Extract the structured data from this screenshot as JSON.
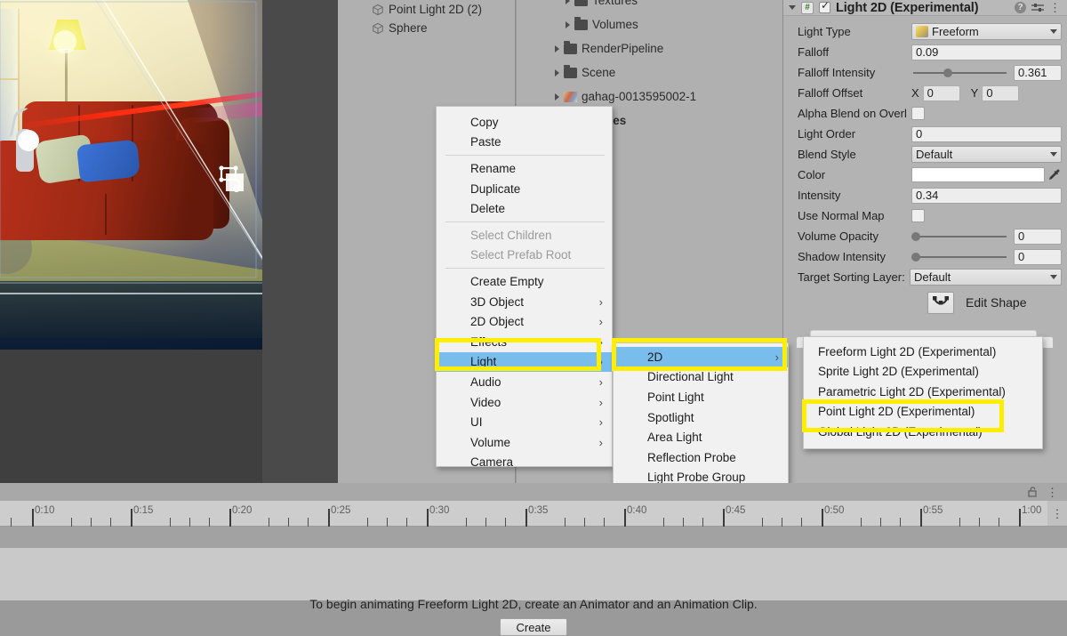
{
  "scene_view": {
    "gizmo_icon": "light-2d-shape-gizmo-icon",
    "description": "2D lit living room scene with red sofa, lamp, cat and pillows"
  },
  "hierarchy": {
    "items": [
      {
        "label": "Point Light 2D (2)",
        "icon": "cube-icon"
      },
      {
        "label": "Sphere",
        "icon": "cube-icon"
      }
    ]
  },
  "project": {
    "items": [
      {
        "label": "Textures",
        "icon": "folder-icon",
        "indent": 2,
        "bold": false,
        "clipped": true
      },
      {
        "label": "Volumes",
        "icon": "folder-icon",
        "indent": 2,
        "bold": false,
        "clipped": false
      },
      {
        "label": "RenderPipeline",
        "icon": "folder-icon",
        "indent": 1,
        "bold": false,
        "clipped": false
      },
      {
        "label": "Scene",
        "icon": "folder-icon",
        "indent": 1,
        "bold": false,
        "clipped": false
      },
      {
        "label": "gahag-0013595002-1",
        "icon": "image-thumb-icon",
        "indent": 1,
        "bold": false,
        "clipped": false
      },
      {
        "label": "Packages",
        "icon": "folder-icon",
        "indent": 0,
        "bold": true,
        "clipped": false
      }
    ]
  },
  "inspector": {
    "title": "Light 2D (Experimental)",
    "enabled": true,
    "icons": {
      "foldout": "chevron-down-icon",
      "script": "script-icon",
      "help": "help-icon",
      "preset": "preset-icon",
      "menu": "kebab-menu-icon"
    },
    "fields": {
      "light_type": {
        "label": "Light Type",
        "value": "Freeform"
      },
      "falloff": {
        "label": "Falloff",
        "value": "0.09"
      },
      "falloff_intensity": {
        "label": "Falloff Intensity",
        "value": "0.361",
        "slider_pct": 36
      },
      "falloff_offset": {
        "label": "Falloff Offset",
        "x_label": "X",
        "x_value": "0",
        "y_label": "Y",
        "y_value": "0"
      },
      "alpha_blend": {
        "label": "Alpha Blend on Overl",
        "checked": false
      },
      "light_order": {
        "label": "Light Order",
        "value": "0"
      },
      "blend_style": {
        "label": "Blend Style",
        "value": "Default"
      },
      "color": {
        "label": "Color",
        "value": "#ffffff"
      },
      "intensity": {
        "label": "Intensity",
        "value": "0.34"
      },
      "use_normal_map": {
        "label": "Use Normal Map",
        "checked": false
      },
      "volume_opacity": {
        "label": "Volume Opacity",
        "value": "0",
        "slider_pct": 0
      },
      "shadow_intensity": {
        "label": "Shadow Intensity",
        "value": "0",
        "slider_pct": 0
      },
      "target_sorting_layer": {
        "label": "Target Sorting Layer:",
        "value": "Default"
      }
    },
    "edit_shape": {
      "label": "Edit Shape",
      "icon": "edit-shape-icon"
    }
  },
  "context_menu": {
    "items": [
      {
        "label": "Copy",
        "type": "item"
      },
      {
        "label": "Paste",
        "type": "item"
      },
      {
        "label": "",
        "type": "separator"
      },
      {
        "label": "Rename",
        "type": "item"
      },
      {
        "label": "Duplicate",
        "type": "item"
      },
      {
        "label": "Delete",
        "type": "item"
      },
      {
        "label": "",
        "type": "separator"
      },
      {
        "label": "Select Children",
        "type": "disabled"
      },
      {
        "label": "Select Prefab Root",
        "type": "disabled"
      },
      {
        "label": "",
        "type": "separator"
      },
      {
        "label": "Create Empty",
        "type": "item"
      },
      {
        "label": "3D Object",
        "type": "submenu"
      },
      {
        "label": "2D Object",
        "type": "submenu"
      },
      {
        "label": "Effects",
        "type": "submenu"
      },
      {
        "label": "Light",
        "type": "submenu",
        "selected": true
      },
      {
        "label": "Audio",
        "type": "submenu"
      },
      {
        "label": "Video",
        "type": "submenu"
      },
      {
        "label": "UI",
        "type": "submenu"
      },
      {
        "label": "Volume",
        "type": "submenu"
      },
      {
        "label": "Camera",
        "type": "item"
      }
    ]
  },
  "light_submenu": {
    "items": [
      {
        "label": "2D",
        "type": "submenu",
        "selected": true
      },
      {
        "label": "Directional Light",
        "type": "item"
      },
      {
        "label": "Point Light",
        "type": "item"
      },
      {
        "label": "Spotlight",
        "type": "item"
      },
      {
        "label": "Area Light",
        "type": "item"
      },
      {
        "label": "Reflection Probe",
        "type": "item"
      },
      {
        "label": "Light Probe Group",
        "type": "item"
      }
    ]
  },
  "light2d_submenu": {
    "items": [
      {
        "label": "Freeform Light 2D (Experimental)",
        "selected": false
      },
      {
        "label": "Sprite Light 2D (Experimental)",
        "selected": false
      },
      {
        "label": "Parametric Light 2D (Experimental)",
        "selected": false
      },
      {
        "label": "Point Light 2D (Experimental)",
        "selected": true
      },
      {
        "label": "Global Light 2D (Experimental)",
        "selected": false
      }
    ]
  },
  "highlights": {
    "color": "#ffee00",
    "boxes": [
      "Light",
      "2D",
      "Point Light 2D (Experimental)"
    ]
  },
  "animation_panel": {
    "lock_icon": "lock-open-icon",
    "menu_icon": "kebab-menu-icon",
    "ruler_labels": [
      "0:10",
      "0:15",
      "0:20",
      "0:25",
      "0:30",
      "0:35",
      "0:40",
      "0:45",
      "0:50",
      "0:55",
      "1:00"
    ],
    "message": "To begin animating Freeform Light 2D, create an Animator and an Animation Clip.",
    "create_button": "Create"
  }
}
